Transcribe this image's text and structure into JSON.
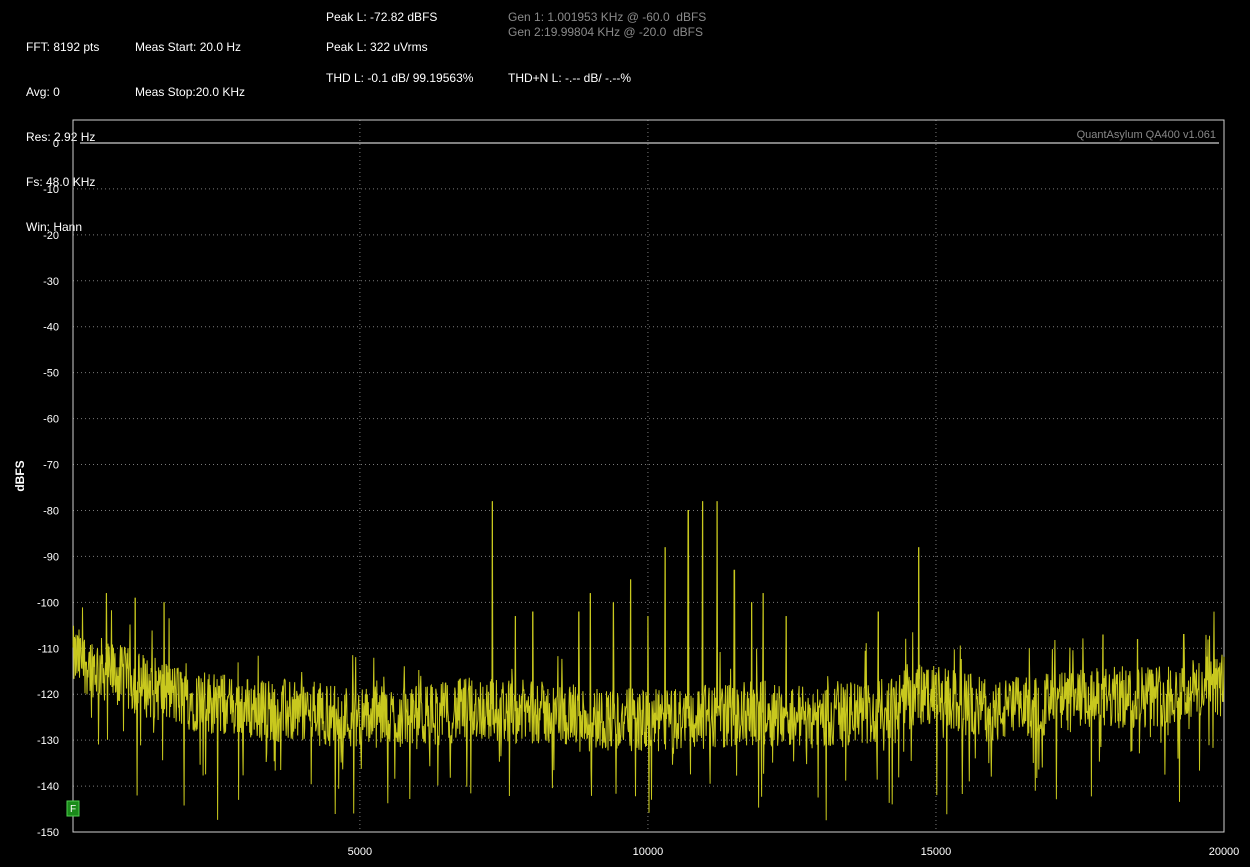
{
  "header": {
    "col1": [
      "FFT: 8192 pts",
      "Avg: 0",
      "Res: 2.92 Hz",
      "Fs: 48.0 KHz",
      "Win: Hann"
    ],
    "col2": [
      "Meas Start: 20.0 Hz",
      "Meas Stop:20.0 KHz"
    ],
    "peak_dbfs": "Peak L: -72.82 dBFS",
    "peak_vrms": "Peak L: 322 uVrms",
    "thd": "THD L: -0.1 dB/ 99.19563%",
    "thdn": "THD+N L: -.-- dB/ -.--%",
    "gen1": "Gen 1: 1.001953 KHz @ -60.0  dBFS",
    "gen2": "Gen 2:19.99804 KHz @ -20.0  dBFS"
  },
  "colors": {
    "trace": "#c8c81e",
    "grid": "#7a7a7a",
    "border": "#cfcfcf",
    "background": "#000000",
    "marker": "#1a8a1a"
  },
  "chart_data": {
    "type": "line",
    "brand": "QuantAsylum QA400 v1.061",
    "ylabel": "dBFS",
    "xlim": [
      20,
      20000
    ],
    "ylim": [
      -150,
      0
    ],
    "x_ticks": [
      5000,
      10000,
      15000,
      20000
    ],
    "y_ticks": [
      0,
      -10,
      -20,
      -30,
      -40,
      -50,
      -60,
      -70,
      -80,
      -90,
      -100,
      -110,
      -120,
      -130,
      -140,
      -150
    ],
    "grid": true,
    "marker_label": "F",
    "noise_floor": [
      [
        20,
        -112
      ],
      [
        1000,
        -117
      ],
      [
        2000,
        -121
      ],
      [
        3000,
        -123
      ],
      [
        4000,
        -124
      ],
      [
        5000,
        -125
      ],
      [
        6000,
        -125
      ],
      [
        7000,
        -123
      ],
      [
        8000,
        -124
      ],
      [
        9000,
        -125
      ],
      [
        10000,
        -126
      ],
      [
        11000,
        -125
      ],
      [
        12000,
        -124
      ],
      [
        13000,
        -125
      ],
      [
        14000,
        -124
      ],
      [
        14700,
        -120
      ],
      [
        15500,
        -122
      ],
      [
        16000,
        -124
      ],
      [
        17000,
        -122
      ],
      [
        18000,
        -121
      ],
      [
        19000,
        -120
      ],
      [
        20000,
        -118
      ]
    ],
    "spurs": [
      {
        "x": 600,
        "y": -98
      },
      {
        "x": 1100,
        "y": -99
      },
      {
        "x": 1600,
        "y": -100
      },
      {
        "x": 7300,
        "y": -78
      },
      {
        "x": 7700,
        "y": -103
      },
      {
        "x": 8000,
        "y": -102
      },
      {
        "x": 8800,
        "y": -102
      },
      {
        "x": 9000,
        "y": -98
      },
      {
        "x": 9400,
        "y": -100
      },
      {
        "x": 9700,
        "y": -95
      },
      {
        "x": 10000,
        "y": -103
      },
      {
        "x": 10300,
        "y": -88
      },
      {
        "x": 10700,
        "y": -80
      },
      {
        "x": 10950,
        "y": -78
      },
      {
        "x": 11200,
        "y": -78
      },
      {
        "x": 11500,
        "y": -93
      },
      {
        "x": 11800,
        "y": -100
      },
      {
        "x": 12000,
        "y": -98
      },
      {
        "x": 12400,
        "y": -103
      },
      {
        "x": 14000,
        "y": -102
      },
      {
        "x": 14700,
        "y": -88
      },
      {
        "x": 17900,
        "y": -107
      },
      {
        "x": 18500,
        "y": -108
      },
      {
        "x": 19300,
        "y": -107
      }
    ]
  }
}
